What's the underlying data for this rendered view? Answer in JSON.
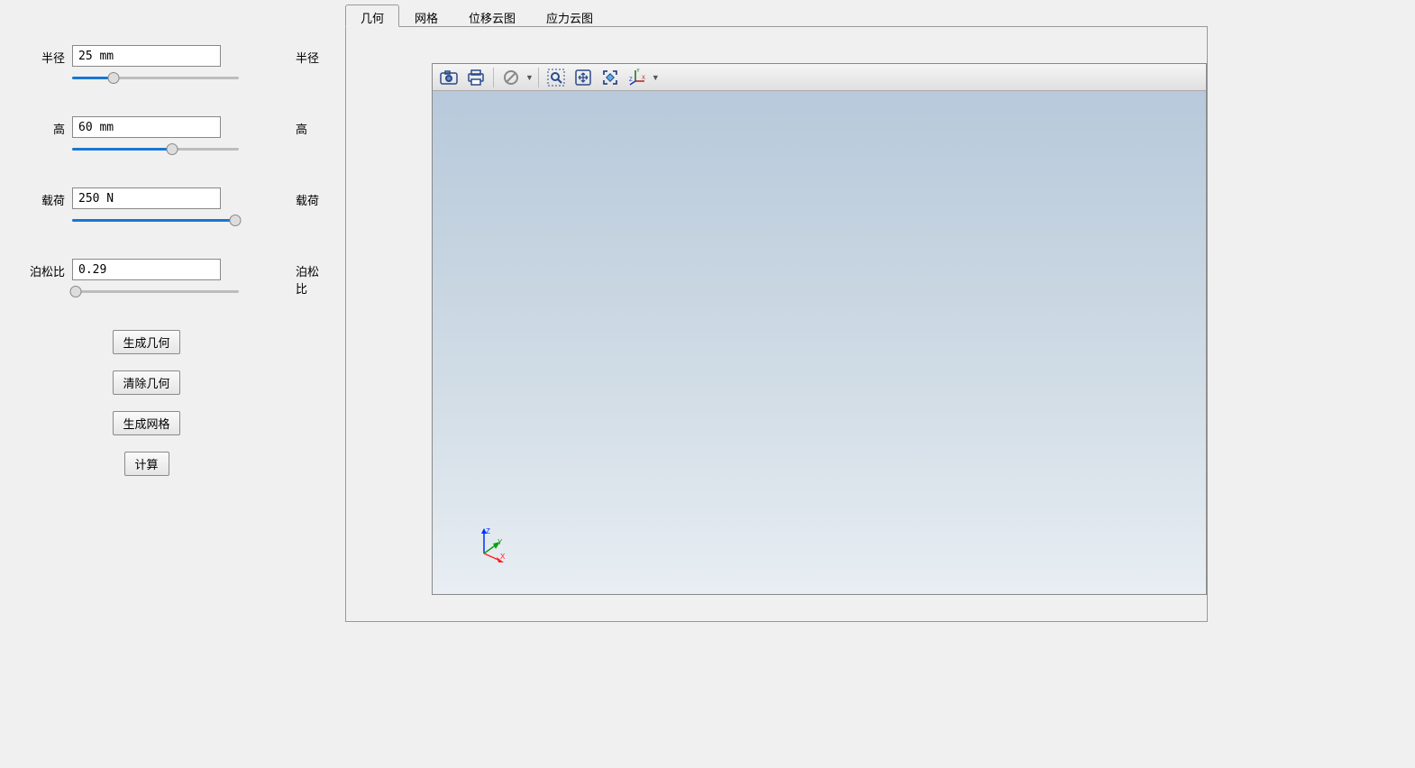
{
  "params": {
    "radius": {
      "label_left": "半径",
      "value": "25 mm",
      "label_right": "半径",
      "slider_pct": 25
    },
    "height": {
      "label_left": "高",
      "value": "60 mm",
      "label_right": "高",
      "slider_pct": 60
    },
    "load": {
      "label_left": "载荷",
      "value": "250 N",
      "label_right": "载荷",
      "slider_pct": 98
    },
    "poisson": {
      "label_left": "泊松比",
      "value": "0.29",
      "label_right": "泊松比",
      "slider_pct": 2
    }
  },
  "buttons": {
    "gen_geom": "生成几何",
    "clear_geom": "清除几何",
    "gen_mesh": "生成网格",
    "calc": "计算"
  },
  "tabs": {
    "geometry": "几何",
    "mesh": "网格",
    "displacement": "位移云图",
    "stress": "应力云图"
  },
  "active_tab": "geometry",
  "toolbar_icons": {
    "camera": "camera-icon",
    "print": "print-icon",
    "cancel": "cancel-icon",
    "zoom_select": "zoom-select-icon",
    "pan": "pan-icon",
    "fit": "fit-icon",
    "axes": "axes-icon"
  },
  "axis_labels": {
    "x": "X",
    "y": "Y",
    "z": "Z"
  }
}
